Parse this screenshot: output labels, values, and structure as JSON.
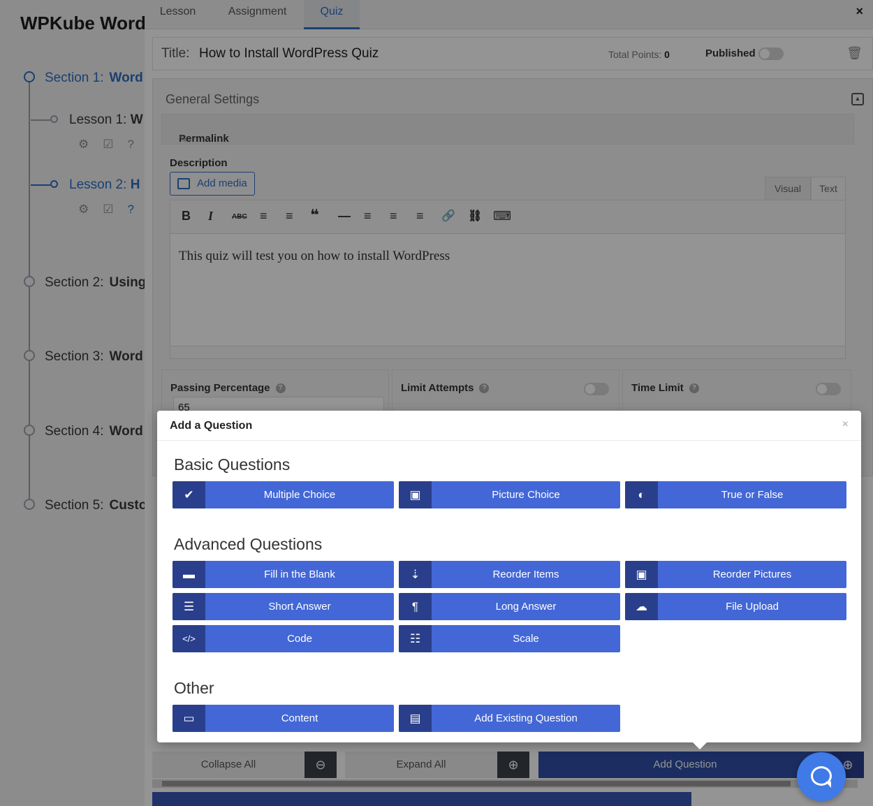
{
  "course": {
    "title": "WPKube Word",
    "sections": [
      {
        "num": "Section 1:",
        "name": "Word"
      },
      {
        "num": "Section 2:",
        "name": "Using"
      },
      {
        "num": "Section 3:",
        "name": "Word"
      },
      {
        "num": "Section 4:",
        "name": "Word"
      },
      {
        "num": "Section 5:",
        "name": "Custo"
      }
    ],
    "lessons": [
      {
        "num": "Lesson 1:",
        "name": "W"
      },
      {
        "num": "Lesson 2:",
        "name": "H"
      }
    ],
    "lesson_icons": [
      "gear-icon",
      "check-square-icon",
      "question-circle-icon"
    ]
  },
  "tabs": [
    {
      "label": "Lesson"
    },
    {
      "label": "Assignment"
    },
    {
      "label": "Quiz"
    }
  ],
  "close_glyph": "×",
  "title_bar": {
    "label": "Title:",
    "value": "How to Install WordPress Quiz",
    "points_label": "Total Points:",
    "points_value": "0",
    "published_label": "Published"
  },
  "general_settings": {
    "title": "General Settings",
    "permalink_label": "Permalink",
    "description_label": "Description",
    "add_media_label": "Add media",
    "visual_tab": "Visual",
    "text_tab": "Text",
    "toolbar": [
      "B",
      "I",
      "ABC",
      "≡",
      "≡",
      "❝",
      "—",
      "≡",
      "≡",
      "≡",
      "🔗",
      "⛓",
      "⌨"
    ],
    "description_text": "This quiz will test you on how to install WordPress"
  },
  "settings_cards": {
    "passing_label": "Passing Percentage",
    "passing_value": "65",
    "limit_label": "Limit Attempts",
    "time_label": "Time Limit"
  },
  "bottom_bar": {
    "collapse_label": "Collapse All",
    "expand_label": "Expand All",
    "add_question_label": "Add Question"
  },
  "modal": {
    "title": "Add a Question",
    "close_glyph": "×",
    "groups": [
      {
        "title": "Basic Questions",
        "buttons": [
          {
            "label": "Multiple Choice",
            "icon": "checkmark-icon",
            "glyph": "✔"
          },
          {
            "label": "Picture Choice",
            "icon": "image-icon",
            "glyph": "▣"
          },
          {
            "label": "True or False",
            "icon": "toggle-icon",
            "glyph": "◐"
          }
        ]
      },
      {
        "title": "Advanced Questions",
        "buttons": [
          {
            "label": "Fill in the Blank",
            "icon": "minus-icon",
            "glyph": "▬"
          },
          {
            "label": "Reorder Items",
            "icon": "sort-numeric-icon",
            "glyph": "⇣"
          },
          {
            "label": "Reorder Pictures",
            "icon": "image-icon",
            "glyph": "▣"
          },
          {
            "label": "Short Answer",
            "icon": "align-left-icon",
            "glyph": "☰"
          },
          {
            "label": "Long Answer",
            "icon": "paragraph-icon",
            "glyph": "¶"
          },
          {
            "label": "File Upload",
            "icon": "cloud-upload-icon",
            "glyph": "☁"
          },
          {
            "label": "Code",
            "icon": "code-icon",
            "glyph": "</>"
          },
          {
            "label": "Scale",
            "icon": "sliders-icon",
            "glyph": "☷"
          }
        ]
      },
      {
        "title": "Other",
        "buttons": [
          {
            "label": "Content",
            "icon": "window-icon",
            "glyph": "▭"
          },
          {
            "label": "Add Existing Question",
            "icon": "file-icon",
            "glyph": "▤"
          }
        ]
      }
    ]
  },
  "colors": {
    "accent": "#4367d6",
    "accent_dark": "#2a3f8c",
    "link_blue": "#2e6ec7"
  }
}
